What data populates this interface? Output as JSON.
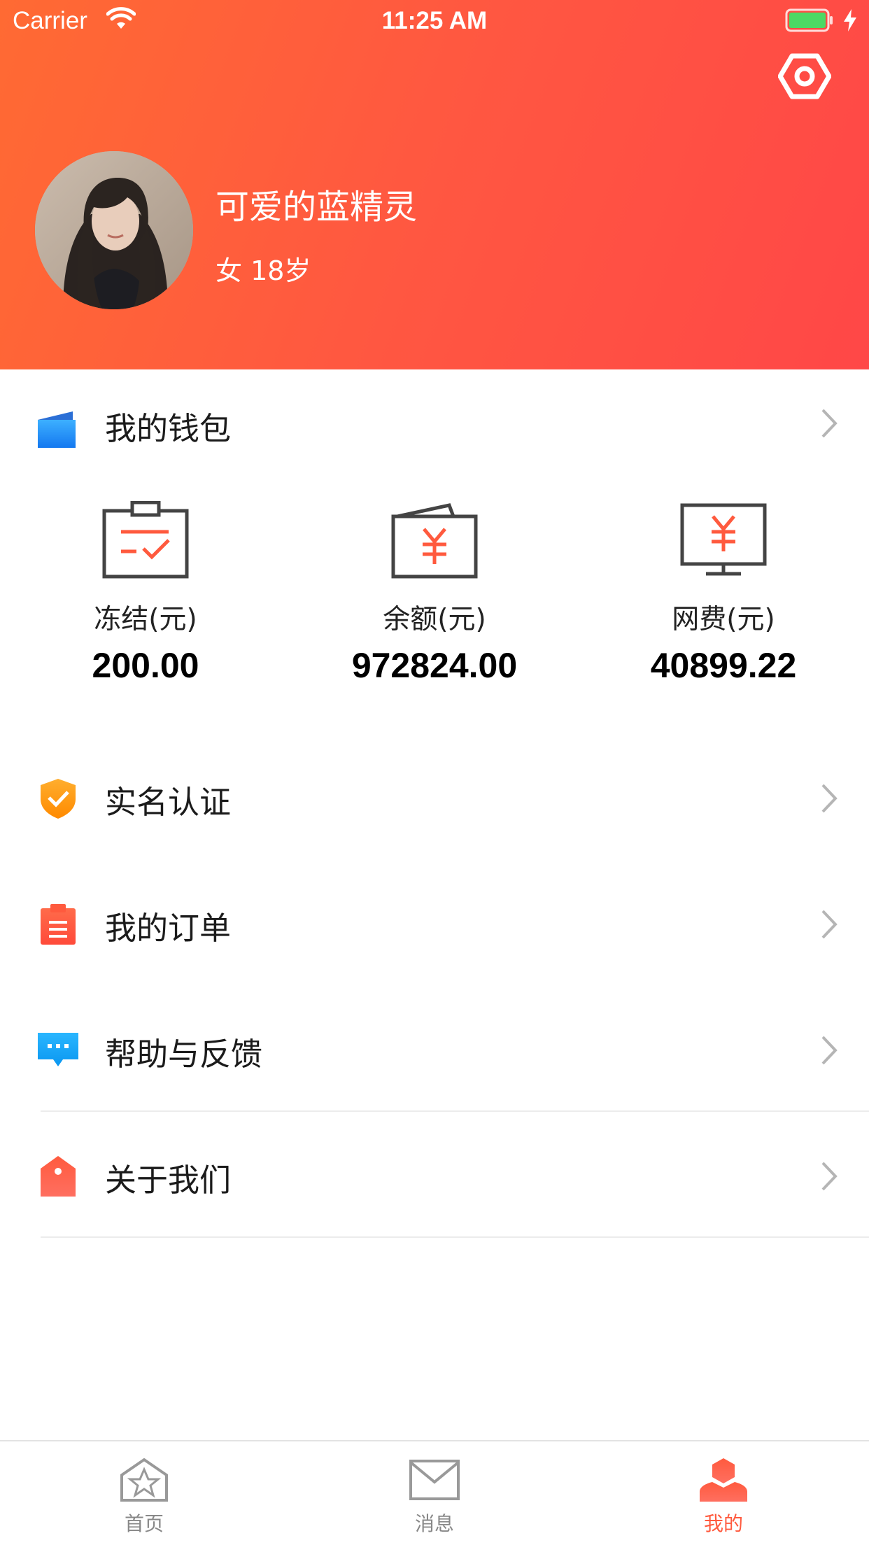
{
  "status_bar": {
    "carrier": "Carrier",
    "time": "11:25 AM"
  },
  "profile": {
    "name": "可爱的蓝精灵",
    "info": "女 18岁"
  },
  "wallet": {
    "title": "我的钱包",
    "items": [
      {
        "label": "冻结(元)",
        "value": "200.00"
      },
      {
        "label": "余额(元)",
        "value": "972824.00"
      },
      {
        "label": "网费(元)",
        "value": "40899.22"
      }
    ]
  },
  "menu": [
    {
      "label": "实名认证"
    },
    {
      "label": "我的订单"
    },
    {
      "label": "帮助与反馈"
    },
    {
      "label": "关于我们"
    }
  ],
  "tabs": [
    {
      "label": "首页"
    },
    {
      "label": "消息"
    },
    {
      "label": "我的"
    }
  ],
  "colors": {
    "header_gradient_start": "#ff6a33",
    "header_gradient_end": "#ff4747",
    "accent": "#ff5a3e",
    "wallet_icon_blue": "#1a8cff",
    "shield_orange": "#ff9f1a",
    "help_blue": "#1aa3ff"
  }
}
